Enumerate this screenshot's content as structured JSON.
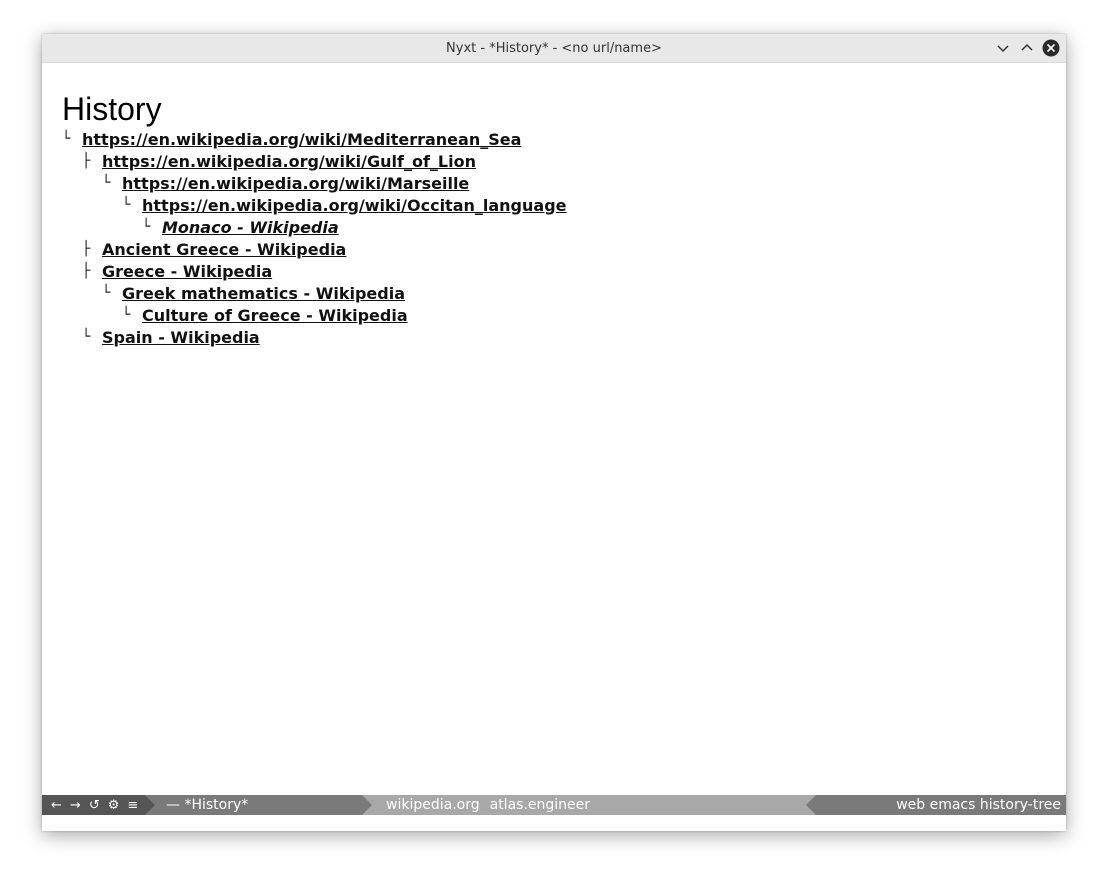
{
  "window": {
    "title": "Nyxt - *History* - <no url/name>",
    "controls": [
      "minimize-icon",
      "maximize-icon",
      "close-icon"
    ]
  },
  "page": {
    "heading": "History"
  },
  "history_tree": [
    {
      "depth": 0,
      "glyph": "└",
      "label": "https://en.wikipedia.org/wiki/Mediterranean_Sea",
      "current": false
    },
    {
      "depth": 1,
      "glyph": "├",
      "label": "https://en.wikipedia.org/wiki/Gulf_of_Lion",
      "current": false
    },
    {
      "depth": 2,
      "glyph": "└",
      "label": "https://en.wikipedia.org/wiki/Marseille",
      "current": false
    },
    {
      "depth": 3,
      "glyph": "└",
      "label": "https://en.wikipedia.org/wiki/Occitan_language",
      "current": false
    },
    {
      "depth": 4,
      "glyph": "└",
      "label": "Monaco - Wikipedia",
      "current": true
    },
    {
      "depth": 1,
      "glyph": "├",
      "label": "Ancient Greece - Wikipedia",
      "current": false
    },
    {
      "depth": 1,
      "glyph": "├",
      "label": "Greece - Wikipedia",
      "current": false
    },
    {
      "depth": 2,
      "glyph": "└",
      "label": "Greek mathematics - Wikipedia",
      "current": false
    },
    {
      "depth": 3,
      "glyph": "└",
      "label": "Culture of Greece - Wikipedia",
      "current": false
    },
    {
      "depth": 1,
      "glyph": "└",
      "label": "Spain - Wikipedia",
      "current": false
    }
  ],
  "statusbar": {
    "controls": {
      "back": "←",
      "forward": "→",
      "reload": "↺",
      "settings": "⚙",
      "menu": "≡"
    },
    "buffer": "— *History*",
    "domains": [
      "wikipedia.org",
      "atlas.engineer"
    ],
    "modes": "web emacs history-tree"
  },
  "colors": {
    "titlebar_bg": "#e8e8e8",
    "statusbar_dark": "#555555",
    "statusbar_mid": "#7a7a7a",
    "statusbar_light": "#a8a8a8",
    "link": "#111111"
  }
}
